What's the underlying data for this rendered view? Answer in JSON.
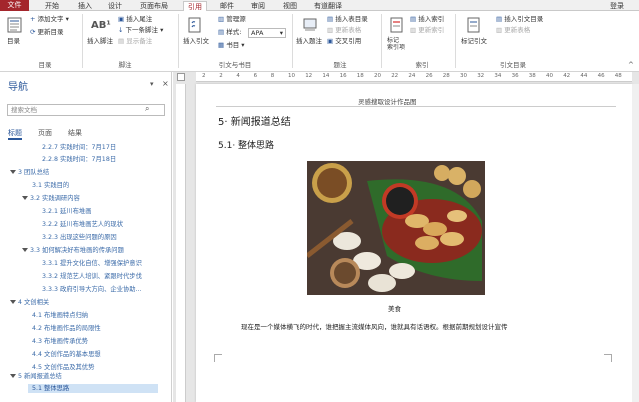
{
  "tabs": {
    "file": "文件",
    "items": [
      "开始",
      "插入",
      "设计",
      "页面布局",
      "引用",
      "邮件",
      "审阅",
      "视图",
      "有道翻译"
    ],
    "active_index": 4,
    "signin": "登录"
  },
  "ribbon": {
    "toc": {
      "big": "目录",
      "add_text": "添加文字",
      "update_toc": "更新目录",
      "group": "目录"
    },
    "footnotes": {
      "insert_footnote": "插入脚注",
      "insert_endnote": "插入尾注",
      "next_footnote": "下一条脚注",
      "show_notes": "显示备注",
      "group": "脚注"
    },
    "citations": {
      "insert_citation": "插入引文",
      "manage_sources": "管理源",
      "style_label": "样式:",
      "style_value": "APA",
      "bibliography": "书目",
      "group": "引文与书目"
    },
    "captions": {
      "insert_caption": "插入题注",
      "insert_table_of_figures": "插入表目录",
      "update_table": "更新表格",
      "cross_reference": "交叉引用",
      "group": "题注"
    },
    "index": {
      "mark_entry": "标记\n索引项",
      "insert_index": "插入索引",
      "update_index": "更新索引",
      "group": "索引"
    },
    "authorities": {
      "mark_citation": "标记引文",
      "insert_toa": "插入引文目录",
      "update_table": "更新表格",
      "group": "引文目录"
    }
  },
  "nav": {
    "title": "导航",
    "search_placeholder": "搜索文档",
    "tabs": [
      "标题",
      "页面",
      "结果"
    ],
    "items": [
      "2.2.7 实践时间：7月17日",
      "2.2.8 实践时间：7月18日",
      "3 团队总结",
      "3.1 实践目的",
      "3.2 实践调研内容",
      "3.2.1 延川布堆画",
      "3.2.2 延川布堆画艺人的现状",
      "3.2.3 出现这些问题的原因",
      "3.3 如何解决好布堆画的传承问题",
      "3.3.1 提升文化自信、增强保护意识",
      "3.3.2 规范艺人培训、紧跟时代步伐",
      "3.3.3 政府引导大方向、企业协助...",
      "4 文创相关",
      "4.1 布堆画特点归纳",
      "4.2 布堆画作品的局限性",
      "4.3 布堆画传承优势",
      "4.4 文创作品的基本思想",
      "4.5 文创作品及其优势",
      "5 新闻报道总结",
      "5.1 整体思路"
    ]
  },
  "ruler": {
    "ticks": [
      "2",
      "2",
      "4",
      "6",
      "8",
      "10",
      "12",
      "14",
      "16",
      "18",
      "20",
      "22",
      "24",
      "26",
      "28",
      "30",
      "32",
      "34",
      "36",
      "38",
      "40",
      "42",
      "44",
      "46",
      "48"
    ]
  },
  "document": {
    "header": "灵感搜取设计作品图",
    "heading1": "5· 新闻报道总结",
    "heading2": "5.1· 整体思路",
    "caption": "美食",
    "body": "现在是一个媒体横飞的时代，谁把握主流媒体风向，谁就具有话语权。根据前期规划设计宣传"
  },
  "colors": {
    "accent": "#a4262c",
    "nav_link": "#3a6aa8",
    "selected": "#cfe2f5"
  }
}
